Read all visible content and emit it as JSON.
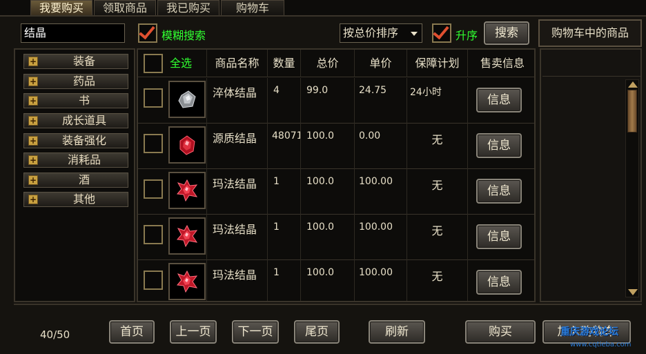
{
  "tabs": [
    {
      "label": "我要购买"
    },
    {
      "label": "领取商品"
    },
    {
      "label": "我已购买"
    },
    {
      "label": "购物车"
    }
  ],
  "search": {
    "value": "结晶",
    "fuzzy_label": "模糊搜索",
    "fuzzy_checked": true,
    "sort_select": "按总价排序",
    "asc_label": "升序",
    "asc_checked": true,
    "search_button": "搜索"
  },
  "cart": {
    "title": "购物车中的商品"
  },
  "categories": [
    {
      "label": "装备"
    },
    {
      "label": "药品"
    },
    {
      "label": "书"
    },
    {
      "label": "成长道具"
    },
    {
      "label": "装备强化"
    },
    {
      "label": "消耗品"
    },
    {
      "label": "酒"
    },
    {
      "label": "其他"
    }
  ],
  "table": {
    "select_all": "全选",
    "headers": [
      "商品名称",
      "数量",
      "总价",
      "单价",
      "保障计划",
      "售卖信息"
    ],
    "info_button": "信息",
    "rows": [
      {
        "name": "淬体结晶",
        "qty": "4",
        "total": "99.0",
        "unit": "24.75",
        "plan": "24小时",
        "gem": "gray-crystal-icon"
      },
      {
        "name": "源质结晶",
        "qty": "48071",
        "total": "100.0",
        "unit": "0.00",
        "plan": "无",
        "gem": "red-crystal-icon"
      },
      {
        "name": "玛法结晶",
        "qty": "1",
        "total": "100.0",
        "unit": "100.00",
        "plan": "无",
        "gem": "red-crystal-icon"
      },
      {
        "name": "玛法结晶",
        "qty": "1",
        "total": "100.0",
        "unit": "100.00",
        "plan": "无",
        "gem": "red-crystal-icon"
      },
      {
        "name": "玛法结晶",
        "qty": "1",
        "total": "100.0",
        "unit": "100.00",
        "plan": "无",
        "gem": "red-crystal-icon"
      }
    ]
  },
  "pagination": {
    "page_info": "40/50",
    "first": "首页",
    "prev": "上一页",
    "next": "下一页",
    "last": "尾页",
    "refresh": "刷新"
  },
  "actions": {
    "buy": "购买",
    "add_to_cart": "加入购物车"
  },
  "watermark": {
    "line1": "重庆游戏论坛",
    "line2": "www.cqtieba.com"
  },
  "colors": {
    "accent_green": "#30ff30",
    "check_red": "#e05030",
    "gold": "#c8a040"
  }
}
